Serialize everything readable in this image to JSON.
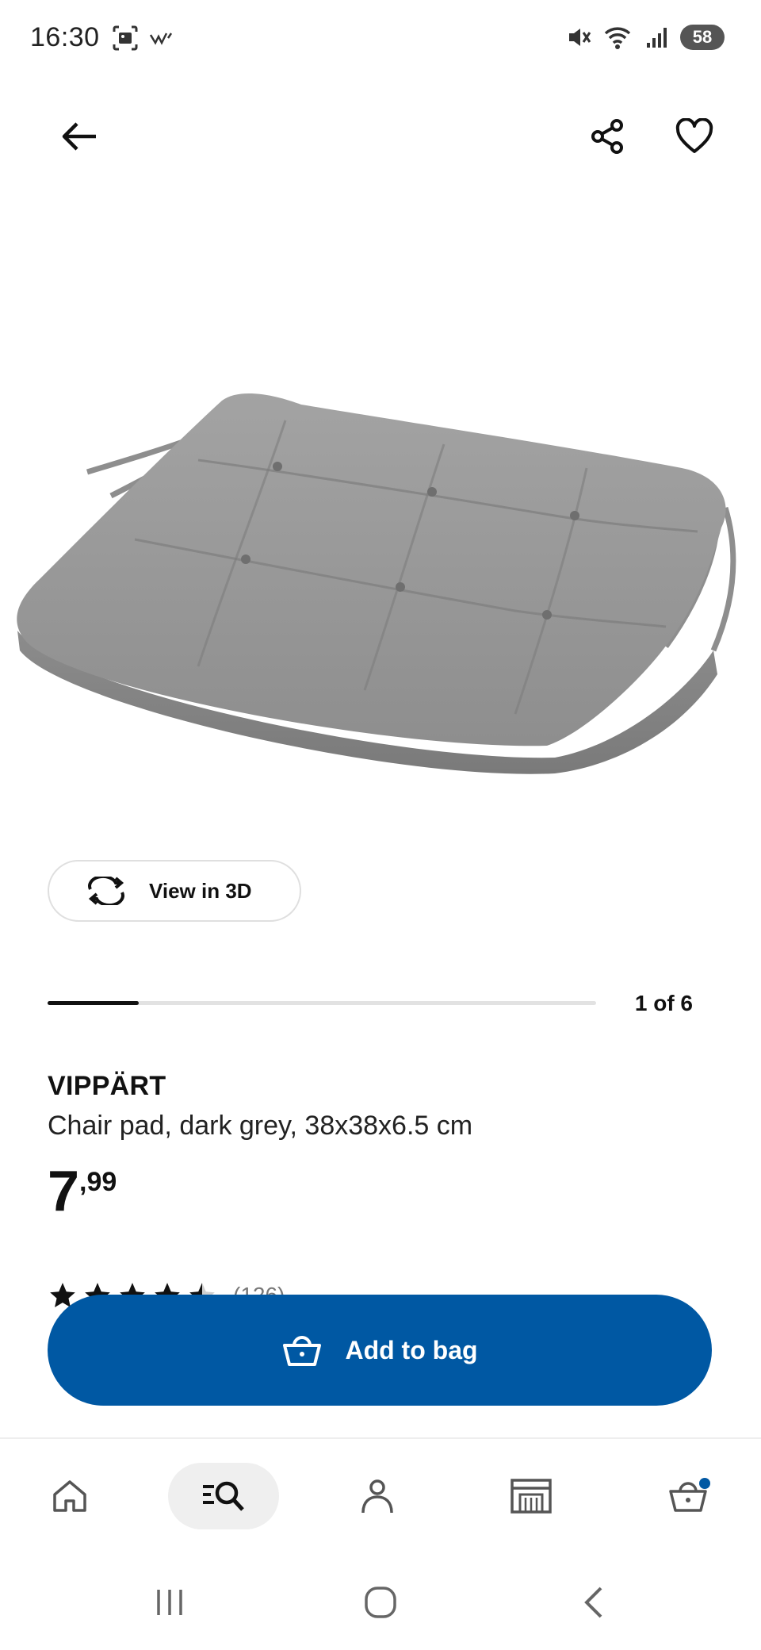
{
  "status_bar": {
    "time": "16:30",
    "battery": "58",
    "icons_left": [
      "screenshot-icon",
      "wifi-calling-icon"
    ],
    "icons_right": [
      "mute-icon",
      "wifi-icon",
      "signal-icon",
      "battery-icon"
    ]
  },
  "top_nav": {
    "icons": [
      "back-arrow-icon",
      "share-icon",
      "heart-icon"
    ]
  },
  "view_3d": {
    "label": "View in 3D"
  },
  "carousel": {
    "counter": "1 of 6",
    "current": 1,
    "total": 6
  },
  "product": {
    "name": "VIPPÄRT",
    "description": "Chair pad, dark grey, 38x38x6.5 cm",
    "price_int": "7",
    "price_dec": ",99",
    "rating": 4.5,
    "rating_count": "(126)"
  },
  "add_to_bag": {
    "label": "Add to bag"
  },
  "bottom_nav": {
    "items": [
      {
        "icon": "home-icon"
      },
      {
        "icon": "search-icon",
        "active": true
      },
      {
        "icon": "profile-icon"
      },
      {
        "icon": "store-icon"
      },
      {
        "icon": "bag-icon",
        "badge": true
      }
    ]
  },
  "colors": {
    "accent": "#0058a3",
    "badge": "#0058a3"
  }
}
